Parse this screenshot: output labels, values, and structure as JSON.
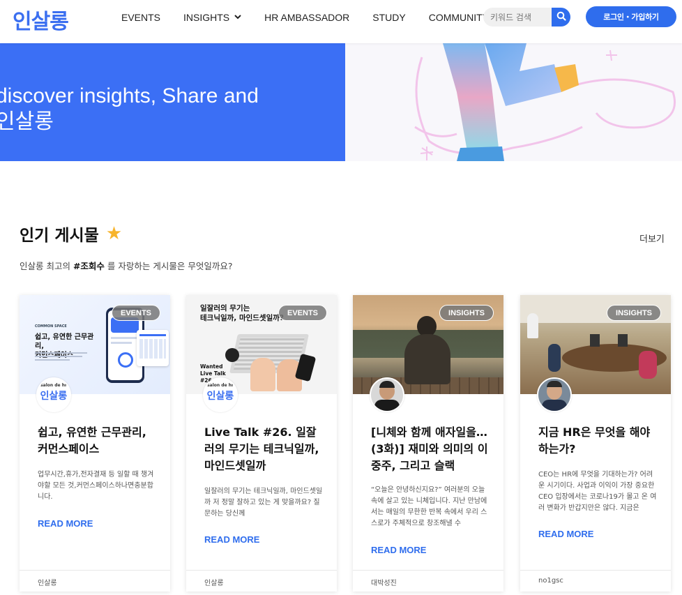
{
  "header": {
    "logo": "인살롱",
    "nav": [
      {
        "label": "EVENTS"
      },
      {
        "label": "INSIGHTS"
      },
      {
        "label": "HR AMBASSADOR"
      },
      {
        "label": "STUDY"
      },
      {
        "label": "COMMUNITY"
      }
    ],
    "search_placeholder": "키워드 검색",
    "login_label": "로그인・가입하기"
  },
  "hero": {
    "line1": "discover insights, Share and",
    "line2": "인살롱"
  },
  "popular": {
    "title": "인기 게시물",
    "more_label": "더보기",
    "subtitle_before": "인살롱 최고의 ",
    "subtitle_bold": "#조회수",
    "subtitle_after": " 를 자랑하는 게시물은 무엇일까요?"
  },
  "cards": [
    {
      "badge": "EVENTS",
      "thumb_title": "쉽고, 유연한 근무관리,\n커먼스페이스",
      "thumb_brand": "COMMON SPACE",
      "avatar_top": "salon de hr",
      "avatar_text": "인살롱",
      "title": "쉽고, 유연한 근무관리, 커먼스페이스",
      "desc": "업무시간,휴가,전자결재 등 일할 때 챙겨야할 모든 것,커먼스페이스하나면충분합니다.",
      "read_more": "READ MORE",
      "author": "인살롱"
    },
    {
      "badge": "EVENTS",
      "thumb_title": "일잘러의 무기는\n테크닉일까, 마인드셋일까?",
      "thumb_sub": "Wanted\nLive Talk\n#26",
      "avatar_top": "salon de hr",
      "avatar_text": "인살롱",
      "title": "Live Talk #26. 일잘러의 무기는 테크닉일까, 마인드셋일까",
      "desc": "일잘러의 무기는 테크닉일까, 마인드셋일까 저 정말 잘하고 있는 게 맞을까요? 질문하는 당신께",
      "read_more": "READ MORE",
      "author": "인살롱"
    },
    {
      "badge": "INSIGHTS",
      "title": "[니체와 함께 애자일을…(3화)] 재미와 의미의 이중주, 그리고 슬랙",
      "desc": "“오늘은 안녕하신지요?” 여러분의 오늘 속에 살고 있는 니체입니다.   지난 만남에서는 매일의 무한한 반복 속에서 우리 스스로가 주체적으로 창조해낼 수",
      "read_more": "READ MORE",
      "author": "대박성진"
    },
    {
      "badge": "INSIGHTS",
      "title": "지금 HR은 무엇을 해야하는가?",
      "desc": "CEO는 HR에 무엇을 기대하는가? 어려운 시기이다. 사업과 이익이 가장 중요한 CEO 입장에서는 코로나19가 몰고 온 여러 변화가 반갑지만은 않다. 지금은",
      "read_more": "READ MORE",
      "author": "no1gsc"
    }
  ],
  "colors": {
    "brand_blue": "#2f6ded",
    "hero_blue": "#3b6ff5",
    "star": "#f7b42c"
  }
}
